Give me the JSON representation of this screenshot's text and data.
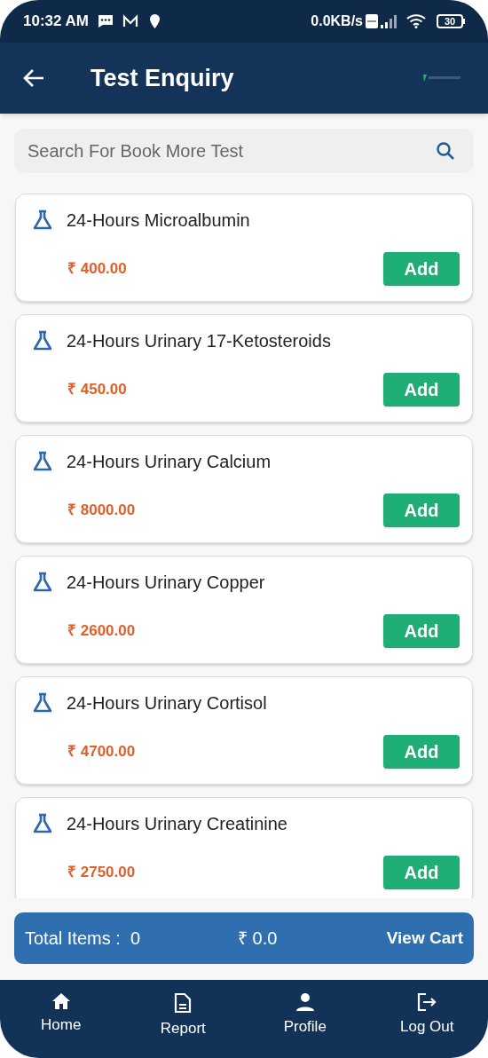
{
  "status_bar": {
    "time": "10:32 AM",
    "speed": "0.0KB/s",
    "battery": "30"
  },
  "header": {
    "title": "Test Enquiry"
  },
  "search": {
    "placeholder": "Search For Book More Test"
  },
  "tests": [
    {
      "name": "24-Hours Microalbumin",
      "price": "₹ 400.00",
      "button": "Add"
    },
    {
      "name": "24-Hours Urinary 17-Ketosteroids",
      "price": "₹ 450.00",
      "button": "Add"
    },
    {
      "name": "24-Hours Urinary Calcium",
      "price": "₹ 8000.00",
      "button": "Add"
    },
    {
      "name": "24-Hours Urinary Copper",
      "price": "₹ 2600.00",
      "button": "Add"
    },
    {
      "name": "24-Hours Urinary Cortisol",
      "price": "₹ 4700.00",
      "button": "Add"
    },
    {
      "name": "24-Hours Urinary Creatinine",
      "price": "₹ 2750.00",
      "button": "Add"
    }
  ],
  "cart": {
    "total_label": "Total Items :  0",
    "amount": "₹ 0.0",
    "action": "View Cart"
  },
  "nav": [
    {
      "kind": "home",
      "label": "Home"
    },
    {
      "kind": "report",
      "label": "Report"
    },
    {
      "kind": "profile",
      "label": "Profile"
    },
    {
      "kind": "logout",
      "label": "Log Out"
    }
  ]
}
